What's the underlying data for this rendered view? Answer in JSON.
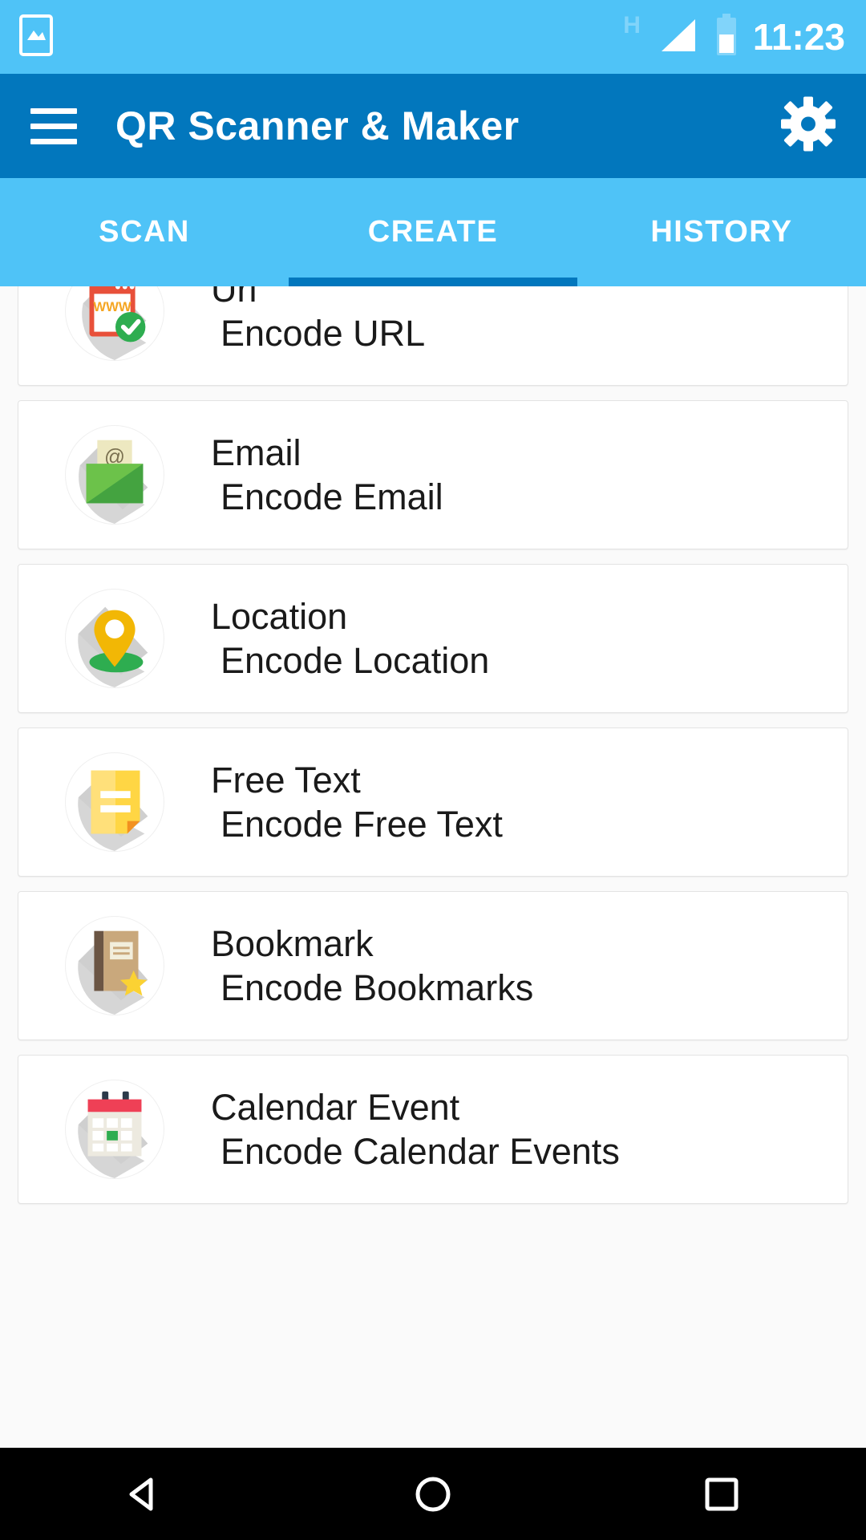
{
  "status_bar": {
    "photo_icon": "image-icon",
    "network_label": "H",
    "signal_icon": "signal-icon",
    "battery_icon": "battery-icon",
    "clock": "11:23"
  },
  "app_bar": {
    "menu_icon": "hamburger-menu-icon",
    "title": "QR Scanner & Maker",
    "settings_icon": "gear-icon"
  },
  "tabs": {
    "items": [
      {
        "label": "SCAN",
        "selected": false
      },
      {
        "label": "CREATE",
        "selected": true
      },
      {
        "label": "HISTORY",
        "selected": false
      }
    ],
    "indicator_color": "#0277BD"
  },
  "create_list": {
    "items": [
      {
        "title": "Url",
        "subtitle": "Encode URL",
        "icon": "url-browser-icon"
      },
      {
        "title": "Email",
        "subtitle": "Encode Email",
        "icon": "email-envelope-icon"
      },
      {
        "title": "Location",
        "subtitle": "Encode Location",
        "icon": "location-pin-icon"
      },
      {
        "title": "Free Text",
        "subtitle": "Encode Free Text",
        "icon": "free-text-note-icon"
      },
      {
        "title": "Bookmark",
        "subtitle": "Encode Bookmarks",
        "icon": "bookmark-book-icon"
      },
      {
        "title": "Calendar Event",
        "subtitle": "Encode Calendar Events",
        "icon": "calendar-icon"
      }
    ]
  },
  "nav_bar": {
    "back": "back-triangle-icon",
    "home": "home-circle-icon",
    "recents": "recents-square-icon"
  },
  "colors": {
    "status_bar": "#4FC3F7",
    "app_bar": "#0277BD",
    "tab_bar": "#4FC3F7",
    "page_bg": "#FAFAFA",
    "card_bg": "#FFFFFF"
  }
}
